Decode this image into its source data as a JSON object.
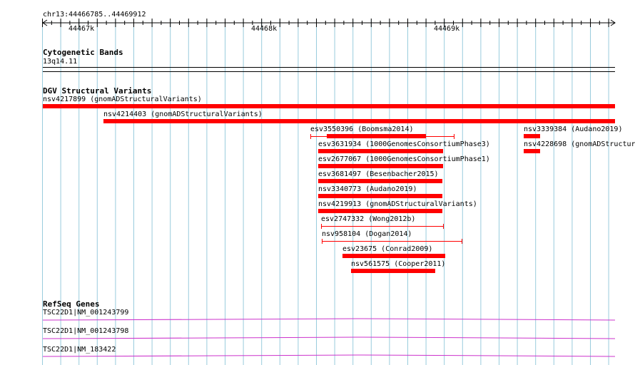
{
  "ruler": {
    "range_label": "chr13:44466785..44469912",
    "ticks": [
      "44467k",
      "44468k",
      "44469k"
    ]
  },
  "tracks": {
    "cytoband": {
      "title": "Cytogenetic Bands",
      "band_label": "13q14.11"
    },
    "dgv": {
      "title": "DGV Structural Variants",
      "features": [
        {
          "label": "nsv4217899 (gnomADStructuralVariants)",
          "style": "thick"
        },
        {
          "label": "nsv4214403 (gnomADStructuralVariants)",
          "style": "thick"
        },
        {
          "label": "esv3550396 (Boomsma2014)",
          "style": "mixed"
        },
        {
          "label": "nsv3339384 (Audano2019)",
          "style": "thick"
        },
        {
          "label": "esv3631934 (1000GenomesConsortiumPhase3)",
          "style": "thick"
        },
        {
          "label": "nsv4228698 (gnomADStructur",
          "style": "thick"
        },
        {
          "label": "esv2677067 (1000GenomesConsortiumPhase1)",
          "style": "thick"
        },
        {
          "label": "esv3681497 (Besenbacher2015)",
          "style": "thick"
        },
        {
          "label": "nsv3340773 (Audano2019)",
          "style": "thick"
        },
        {
          "label": "nsv4219913 (gnomADStructuralVariants)",
          "style": "thick"
        },
        {
          "label": "esv2747332 (Wong2012b)",
          "style": "thin"
        },
        {
          "label": "nsv958104 (Dogan2014)",
          "style": "thin"
        },
        {
          "label": "esv23675 (Conrad2009)",
          "style": "thick"
        },
        {
          "label": "nsv561575 (Cooper2011)",
          "style": "thick"
        }
      ]
    },
    "refseq": {
      "title": "RefSeq Genes",
      "genes": [
        {
          "label": "TSC22D1|NM_001243799"
        },
        {
          "label": "TSC22D1|NM_001243798"
        },
        {
          "label": "TSC22D1|NM_183422"
        }
      ]
    }
  },
  "colors": {
    "variant": "#ff0000",
    "gene": "#cc33cc",
    "grid": "#99ccdd",
    "ruler": "#000000"
  }
}
